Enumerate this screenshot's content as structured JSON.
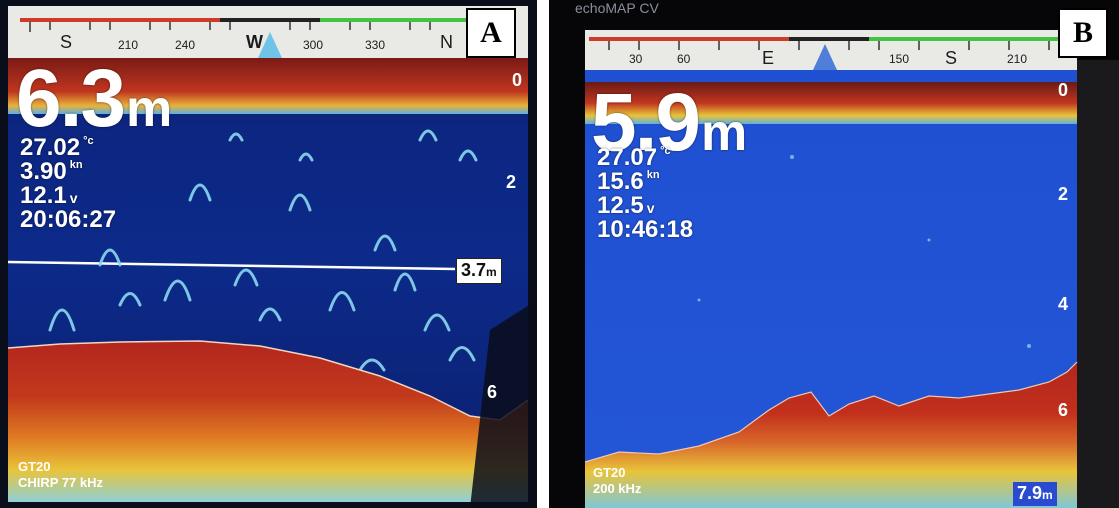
{
  "figure": {
    "panels": [
      {
        "label": "A",
        "compass": {
          "big": [
            "S",
            "W",
            "N"
          ],
          "small": [
            "210",
            "240",
            "300",
            "330"
          ]
        },
        "depth_value": "6.3",
        "depth_unit": "m",
        "temperature": "27.02",
        "temperature_unit": "°c",
        "speed": "3.90",
        "speed_unit": "kn",
        "voltage": "12.1",
        "voltage_unit": "v",
        "time": "20:06:27",
        "depth_line_value": "3.7",
        "depth_line_unit": "m",
        "scale_marks": [
          "0",
          "2",
          "6"
        ],
        "transducer": "GT20",
        "mode": "CHIRP 77 kHz"
      },
      {
        "label": "B",
        "photo_text": "echoMAP CV",
        "compass": {
          "big": [
            "E",
            "S"
          ],
          "small": [
            "30",
            "60",
            "150",
            "210"
          ]
        },
        "depth_value": "5.9",
        "depth_unit": "m",
        "temperature": "27.07",
        "temperature_unit": "°c",
        "speed": "15.6",
        "speed_unit": "kn",
        "voltage": "12.5",
        "voltage_unit": "v",
        "time": "10:46:18",
        "scale_marks": [
          "0",
          "2",
          "4",
          "6"
        ],
        "transducer": "GT20",
        "mode": "200 kHz",
        "bottom_depth_value": "7.9",
        "bottom_depth_unit": "m"
      }
    ]
  },
  "colors": {
    "water_deep": "#0d2a8a",
    "water_light": "#2456d8",
    "seabed_red": "#b3261e",
    "seabed_yellow": "#e8c43a",
    "surface_band": "#c0361f",
    "compass_green": "#44c244",
    "compass_red": "#d03a2a",
    "heading_marker": "#6fc3e8"
  }
}
